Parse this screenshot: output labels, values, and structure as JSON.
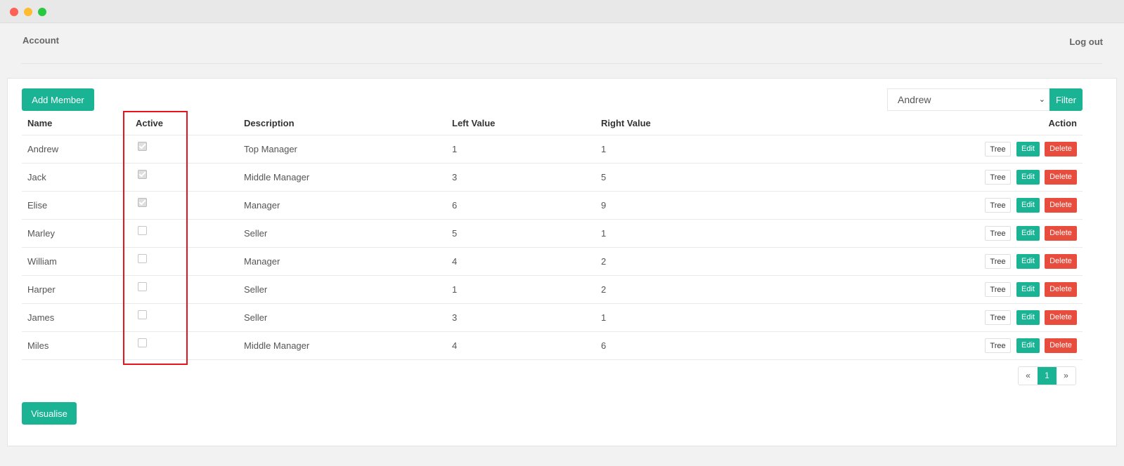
{
  "nav": {
    "account": "Account",
    "logout": "Log out"
  },
  "toolbar": {
    "add_member": "Add Member",
    "filter_value": "Andrew",
    "filter_button": "Filter"
  },
  "table": {
    "headers": [
      "Name",
      "Active",
      "Description",
      "Left Value",
      "Right Value",
      "Action"
    ],
    "rows": [
      {
        "name": "Andrew",
        "active": true,
        "description": "Top Manager",
        "left": "1",
        "right": "1"
      },
      {
        "name": "Jack",
        "active": true,
        "description": "Middle Manager",
        "left": "3",
        "right": "5"
      },
      {
        "name": "Elise",
        "active": true,
        "description": "Manager",
        "left": "6",
        "right": "9"
      },
      {
        "name": "Marley",
        "active": false,
        "description": "Seller",
        "left": "5",
        "right": "1"
      },
      {
        "name": "William",
        "active": false,
        "description": "Manager",
        "left": "4",
        "right": "2"
      },
      {
        "name": "Harper",
        "active": false,
        "description": "Seller",
        "left": "1",
        "right": "2"
      },
      {
        "name": "James",
        "active": false,
        "description": "Seller",
        "left": "3",
        "right": "1"
      },
      {
        "name": "Miles",
        "active": false,
        "description": "Middle Manager",
        "left": "4",
        "right": "6"
      }
    ],
    "actions": {
      "tree": "Tree",
      "edit": "Edit",
      "delete": "Delete"
    }
  },
  "pagination": {
    "prev": "«",
    "current": "1",
    "next": "»"
  },
  "footer": {
    "visualise": "Visualise"
  },
  "colors": {
    "accent": "#1ab394",
    "danger": "#e74c3c",
    "highlight": "#e8141b"
  }
}
